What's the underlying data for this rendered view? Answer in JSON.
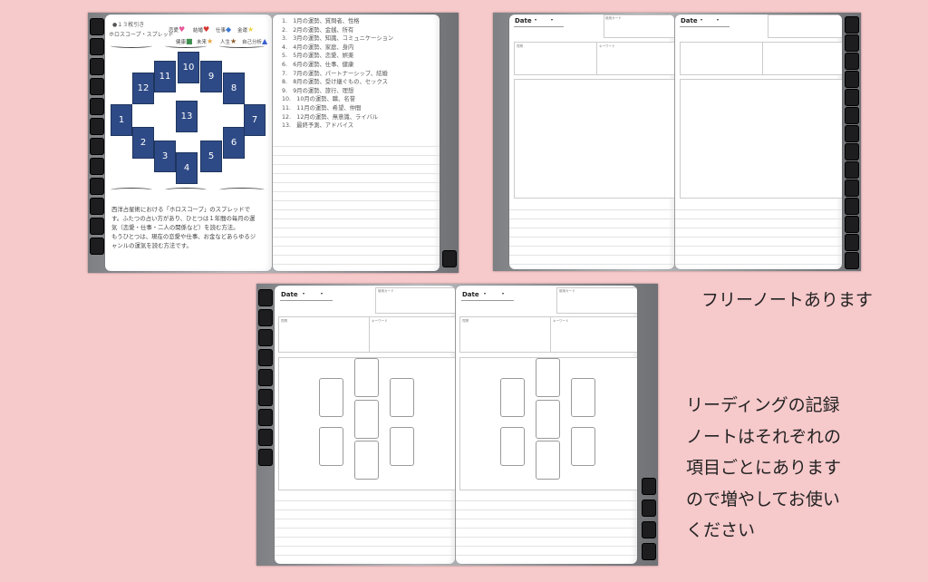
{
  "spread": {
    "header_left": "●１３枚引き",
    "header_title": "ホロスコープ・スプレッド",
    "legend": [
      {
        "label": "恋愛",
        "color": "#e75a9a",
        "shape": "heart"
      },
      {
        "label": "結婚",
        "color": "#d6362f",
        "shape": "heart"
      },
      {
        "label": "仕事",
        "color": "#3a78d0",
        "shape": "diamond"
      },
      {
        "label": "金運",
        "color": "#f0d24a",
        "shape": "star"
      },
      {
        "label": "健康",
        "color": "#3f8f4f",
        "shape": "square"
      },
      {
        "label": "未来",
        "color": "#e8a23a",
        "shape": "star"
      },
      {
        "label": "人生",
        "color": "#8a5a2b",
        "shape": "star"
      },
      {
        "label": "自己分析",
        "color": "#3a5ed0",
        "shape": "triangle"
      }
    ],
    "cards": [
      "1",
      "2",
      "3",
      "4",
      "5",
      "6",
      "7",
      "8",
      "9",
      "10",
      "11",
      "12",
      "13"
    ],
    "description": [
      "西洋占星術における「ホロスコープ」のスプレッドで",
      "す。ふたつの占い方があり、ひとつは１年間の毎月の運",
      "気（恋愛・仕事・二人の関係など）を読む方法。",
      "もうひとつは、現在の恋愛や仕事、お金などあらゆるジ",
      "ャンルの運気を読む方法です。"
    ],
    "meanings": [
      "1.　1月の運勢、質問者、性格",
      "2.　2月の運勢、金銭、所有",
      "3.　3月の運勢、知識、コミュニケーション",
      "4.　4月の運勢、家庭、身内",
      "5.　5月の運勢、恋愛、娯楽",
      "6.　6月の運勢、仕事、健康",
      "7.　7月の運勢、パートナーシップ、結婚",
      "8.　8月の運勢、受け継ぐもの、セックス",
      "9.　9月の運勢、旅行、理想",
      "10.　10月の運勢、職、名誉",
      "11.　11月の運勢、希望、仲間",
      "12.　12月の運勢、無意識、ライバル",
      "13.　最終予測、アドバイス"
    ]
  },
  "note": {
    "date_label": "Date",
    "date_sep": "▾",
    "card_label": "使用カード",
    "theme_label": "質問",
    "keyword_label": "キーワード"
  },
  "captions": {
    "free_note": "フリーノートあります",
    "reading_lines": [
      "リーディングの記録",
      "ノートはそれぞれの",
      "項目ごとにあります",
      "ので増やしてお使い",
      "ください"
    ]
  }
}
